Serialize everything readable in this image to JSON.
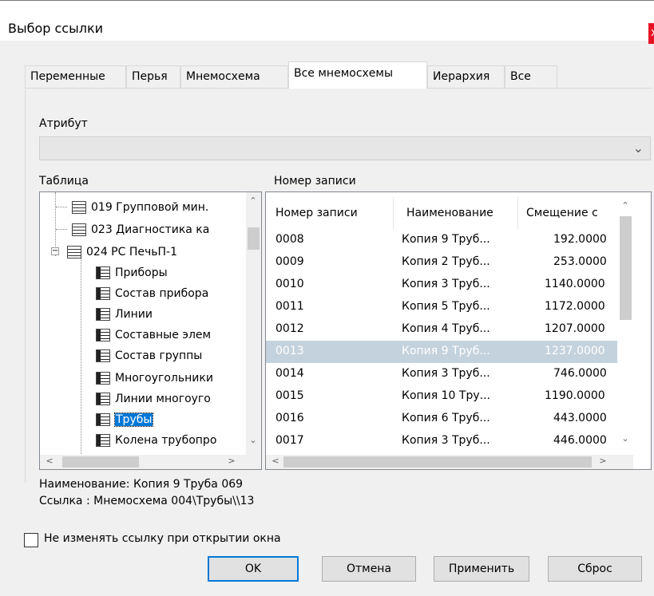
{
  "window": {
    "title": "Выбор ссылки",
    "close_label": "x"
  },
  "tabs": [
    "Переменные",
    "Перья",
    "Мнемосхема",
    "Все мнемосхемы",
    "Иерархия",
    "Все"
  ],
  "active_tab": "Все мнемосхемы",
  "attribute": {
    "label": "Атрибут",
    "value": ""
  },
  "table_label": "Таблица",
  "record_label": "Номер записи",
  "tree": {
    "items": [
      {
        "text": "019 Групповой мин.",
        "level": 1
      },
      {
        "text": "023 Диагностика ка",
        "level": 1
      },
      {
        "text": "024 РС ПечьП-1",
        "level": 1,
        "expanded": true
      },
      {
        "text": "Приборы",
        "level": 2
      },
      {
        "text": "Состав прибора",
        "level": 2
      },
      {
        "text": "Линии",
        "level": 2
      },
      {
        "text": "Составные элем",
        "level": 2
      },
      {
        "text": "Состав группы",
        "level": 2
      },
      {
        "text": "Многоугольники",
        "level": 2
      },
      {
        "text": "Линии многоуго",
        "level": 2
      },
      {
        "text": "Трубы",
        "level": 2,
        "selected": true
      },
      {
        "text": "Колена трубопро",
        "level": 2
      }
    ]
  },
  "records": {
    "columns": [
      "Номер записи",
      "Наименование",
      "Смещение с"
    ],
    "rows": [
      [
        "0008",
        "Копия 9 Труб...",
        "192.0000"
      ],
      [
        "0009",
        "Копия 2 Труб...",
        "253.0000"
      ],
      [
        "0010",
        "Копия 3 Труб...",
        "1140.0000"
      ],
      [
        "0011",
        "Копия 5 Труб...",
        "1172.0000"
      ],
      [
        "0012",
        "Копия 4 Труб...",
        "1207.0000"
      ],
      [
        "0013",
        "Копия 9 Труб...",
        "1237.0000"
      ],
      [
        "0014",
        "Копия 3 Труб...",
        "746.0000"
      ],
      [
        "0015",
        "Копия 10 Тру...",
        "1190.0000"
      ],
      [
        "0016",
        "Копия 6 Труб...",
        "443.0000"
      ],
      [
        "0017",
        "Копия 3 Труб...",
        "446.0000"
      ]
    ],
    "selected_row": "0013"
  },
  "info": {
    "name_line": "Наименование: Копия 9 Труба 069",
    "link_line": "Ссылка :   Мнемосхема 004\\Трубы\\\\13"
  },
  "keep_link_checkbox": {
    "label": "Не изменять ссылку при открытии окна",
    "checked": false
  },
  "buttons": {
    "ok": "OK",
    "cancel": "Отмена",
    "apply": "Применить",
    "reset": "Сброс"
  },
  "colors": {
    "selection": "#0078d7",
    "row_selection": "#c4d2dd",
    "close": "#e81123"
  }
}
